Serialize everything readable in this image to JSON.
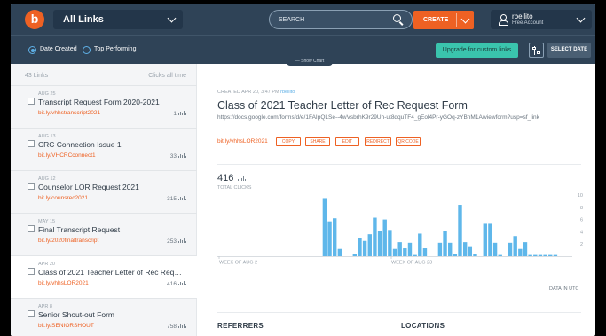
{
  "header": {
    "logo_letter": "b",
    "link_filter": "All Links",
    "search_placeholder": "SEARCH",
    "create_label": "CREATE",
    "account": {
      "username": "rbellito",
      "plan": "Free Account"
    }
  },
  "subheader": {
    "radio_date_created": "Date Created",
    "radio_top_performing": "Top Performing",
    "upgrade_label": "Upgrade for custom links",
    "select_date_label": "SELECT DATE",
    "show_chart_label": "Show Chart"
  },
  "sidebar": {
    "count": "43 Links",
    "sort_label": "Clicks all time",
    "items": [
      {
        "date": "AUG 25",
        "title": "Transcript Request Form 2020-2021",
        "short": "bit.ly/vhhstranscript2021",
        "clicks": "1"
      },
      {
        "date": "AUG 13",
        "title": "CRC Connection Issue 1",
        "short": "bit.ly/VHCRCconnect1",
        "clicks": "33"
      },
      {
        "date": "AUG 12",
        "title": "Counselor LOR Request 2021",
        "short": "bit.ly/counsrec2021",
        "clicks": "315"
      },
      {
        "date": "MAY 15",
        "title": "Final Transcript Request",
        "short": "bit.ly/2020finaltranscript",
        "clicks": "253"
      },
      {
        "date": "APR 20",
        "title": "Class of 2021 Teacher Letter of Rec Request Form",
        "short": "bit.ly/vhhsLOR2021",
        "clicks": "416"
      },
      {
        "date": "APR 8",
        "title": "Senior Shout-out Form",
        "short": "bit.ly/SENIORSHOUT",
        "clicks": "758"
      }
    ]
  },
  "detail": {
    "created": "CREATED APR 20, 3:47 PM",
    "created_by": "rbellito",
    "title": "Class of 2021 Teacher Letter of Rec Request Form",
    "long_url": "https://docs.google.com/forms/d/e/1FAIpQLSe--4wVsbrhK9r29Uh-ut8dquTF4_gEol4Pr-yGOq-zYBnM1A/viewform?usp=sf_link",
    "short_link": "bit.ly/vhhsLOR2021",
    "actions": [
      "COPY",
      "SHARE",
      "EDIT",
      "REDIRECT",
      "QR CODE"
    ],
    "total_clicks": "416",
    "total_clicks_label": "TOTAL CLICKS",
    "data_note": "DATA IN UTC",
    "referrers_label": "REFERRERS",
    "locations_label": "LOCATIONS"
  },
  "chart_data": {
    "type": "bar",
    "bar_color": "#5fb7ea",
    "x_tick_labels": [
      "WEEK OF AUG 2",
      "WEEK OF AUG 23"
    ],
    "y_ticks": [
      2,
      4,
      6,
      8,
      10
    ],
    "ylim": [
      0,
      10
    ],
    "values": [
      0,
      0,
      0,
      0,
      0,
      0,
      0,
      0,
      0,
      0,
      0,
      0,
      0,
      0,
      0,
      0,
      0,
      0,
      0,
      0,
      0,
      9.5,
      5.7,
      6.2,
      1.2,
      0,
      0,
      0.3,
      3,
      2.5,
      3.6,
      6.3,
      4.2,
      6,
      4.3,
      1.2,
      2.3,
      1.3,
      2.2,
      0.2,
      3.7,
      1.3,
      0,
      0,
      2.2,
      4.2,
      2.2,
      0.3,
      8.4,
      2.3,
      1.5,
      0.3,
      0,
      5.3,
      5.3,
      2.2,
      0.2,
      0,
      2.2,
      3.3,
      1.2,
      2.3,
      0.2,
      0.2,
      0.2,
      0.2,
      0.2,
      0.2,
      0
    ]
  }
}
